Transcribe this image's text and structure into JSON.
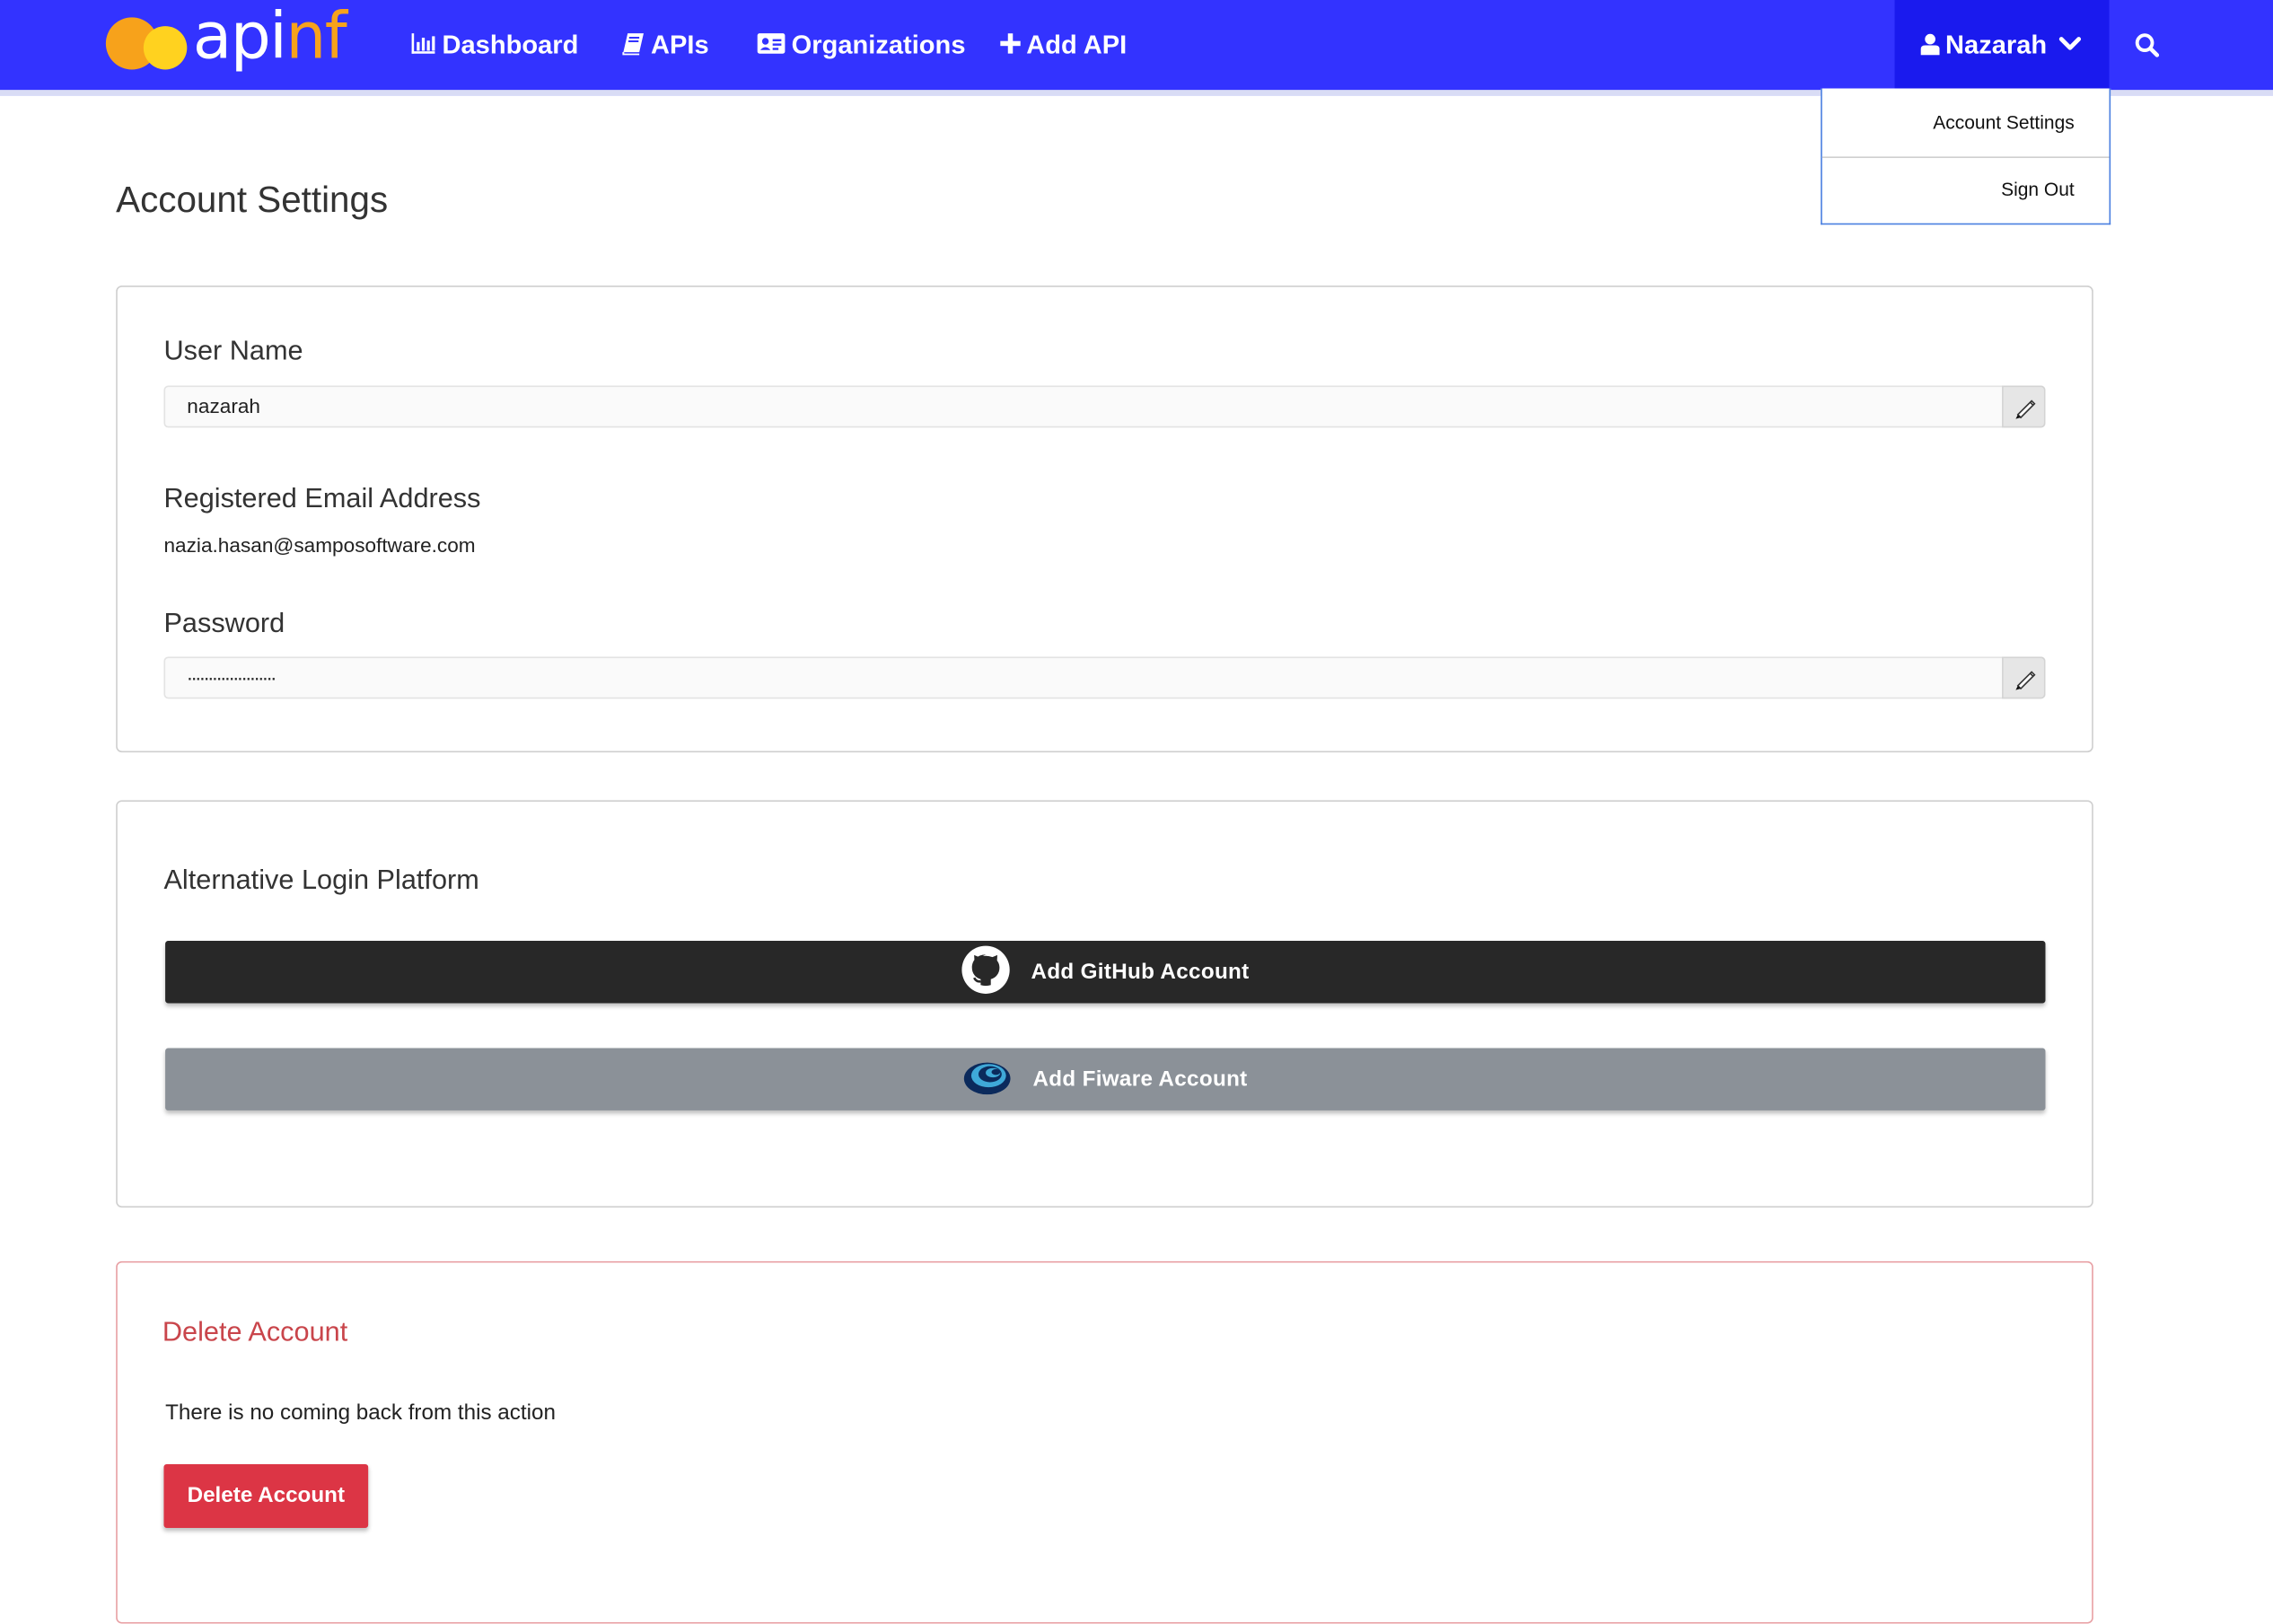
{
  "brand": {
    "part1": "api",
    "part2": "nf"
  },
  "nav": {
    "dashboard": "Dashboard",
    "apis": "APIs",
    "organizations": "Organizations",
    "add_api": "Add API"
  },
  "user_menu": {
    "name": "Nazarah",
    "items": [
      "Account Settings",
      "Sign Out"
    ]
  },
  "page": {
    "title": "Account Settings"
  },
  "profile": {
    "username_label": "User Name",
    "username_value": "nazarah",
    "email_label": "Registered Email Address",
    "email_value": "nazia.hasan@samposoftware.com",
    "password_label": "Password",
    "password_value": "....................."
  },
  "alt_login": {
    "heading": "Alternative Login Platform",
    "github_label": "Add GitHub Account",
    "fiware_label": "Add Fiware Account"
  },
  "delete": {
    "heading": "Delete Account",
    "warning": "There is no coming back from this action",
    "button_label": "Delete Account"
  },
  "icons": {
    "dashboard": "bar-chart-icon",
    "apis": "book-icon",
    "organizations": "id-card-icon",
    "add_api": "plus-icon",
    "user": "user-icon",
    "dropdown": "chevron-down-icon",
    "search": "search-icon",
    "edit": "pencil-icon",
    "github": "github-icon",
    "fiware": "fiware-icon"
  },
  "colors": {
    "navbar": "#3333ff",
    "user_menu": "#1a1aee",
    "brand_accent": "#f7a21b",
    "github_button": "#282828",
    "fiware_button": "#8b9198",
    "danger": "#dc3545",
    "danger_text": "#c9454b"
  }
}
